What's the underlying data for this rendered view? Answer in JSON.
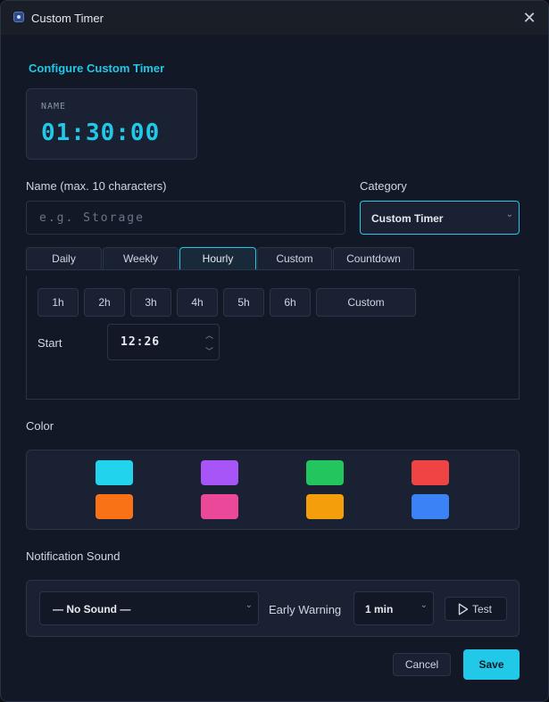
{
  "window": {
    "title": "Custom Timer"
  },
  "form": {
    "heading": "Configure Custom Timer"
  },
  "preview": {
    "label": "NAME",
    "time": "01:30:00"
  },
  "name_field": {
    "label": "Name (max. 10 characters)",
    "value": "",
    "placeholder": "e.g. Storage"
  },
  "category": {
    "label": "Category",
    "selected": "Custom Timer"
  },
  "tabs": [
    {
      "label": "Daily",
      "active": false
    },
    {
      "label": "Weekly",
      "active": false
    },
    {
      "label": "Hourly",
      "active": true
    },
    {
      "label": "Custom",
      "active": false
    },
    {
      "label": "Countdown",
      "active": false
    }
  ],
  "hourly": {
    "intervals": [
      "1h",
      "2h",
      "3h",
      "4h",
      "5h",
      "6h",
      "Custom"
    ],
    "start_label": "Start",
    "start_time": "12:26"
  },
  "color": {
    "label": "Color",
    "swatches": [
      "#22d3ee",
      "#a855f7",
      "#22c55e",
      "#ef4444",
      "#f97316",
      "#ec4899",
      "#f59e0b",
      "#3b82f6"
    ]
  },
  "sound": {
    "label": "Notification Sound",
    "selected": "— No Sound —",
    "early_warning_label": "Early Warning",
    "early_warning_value": "1 min",
    "test_label": "Test"
  },
  "actions": {
    "cancel_label": "Cancel",
    "save_label": "Save"
  }
}
